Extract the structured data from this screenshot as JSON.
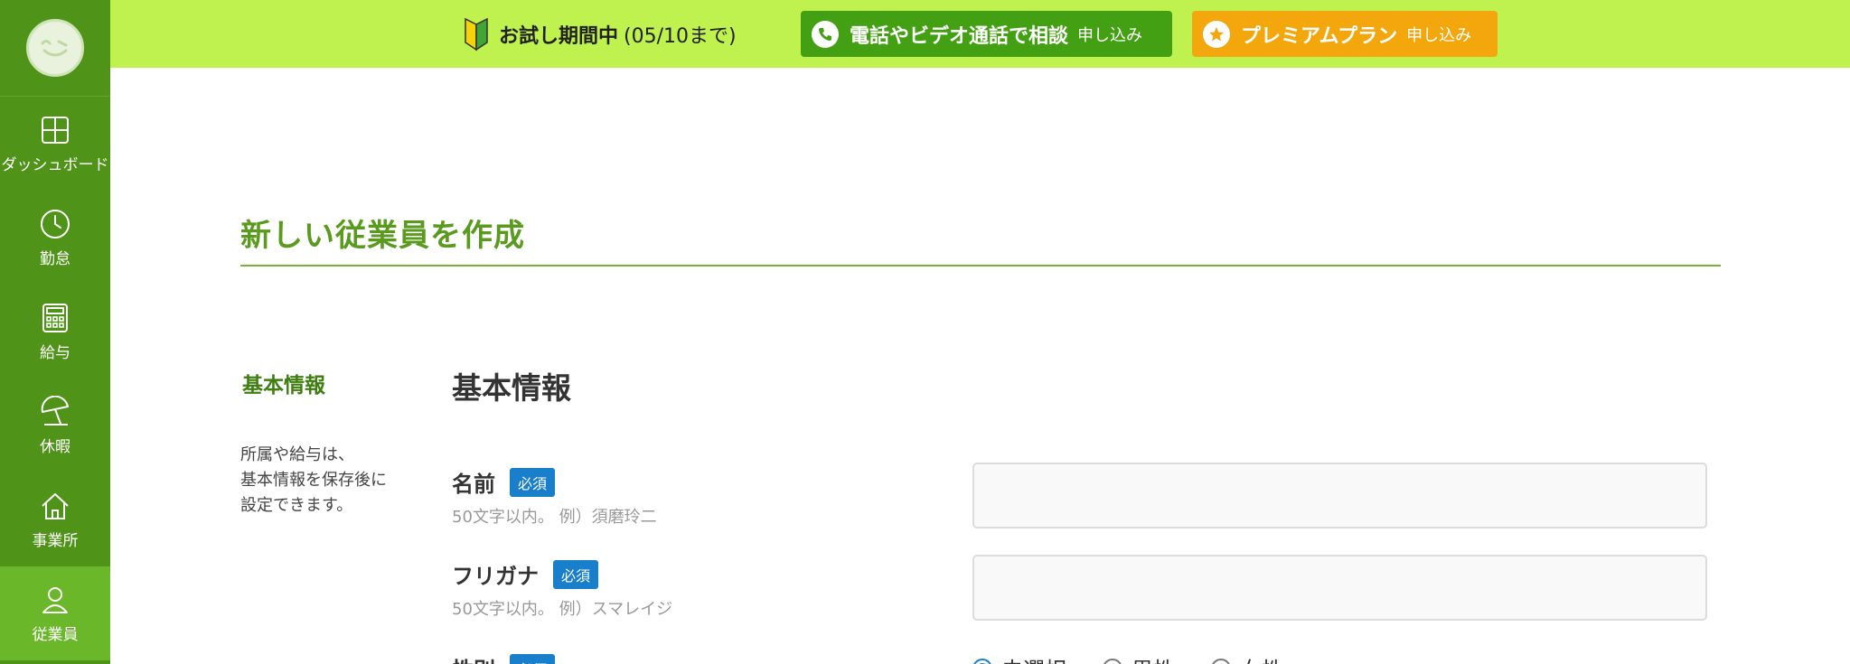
{
  "sidebar": {
    "items": [
      {
        "label": "ダッシュボード",
        "icon": "dashboard-icon"
      },
      {
        "label": "勤怠",
        "icon": "clock-icon"
      },
      {
        "label": "給与",
        "icon": "calculator-icon"
      },
      {
        "label": "休暇",
        "icon": "beach-umbrella-icon"
      },
      {
        "label": "事業所",
        "icon": "home-icon"
      },
      {
        "label": "従業員",
        "icon": "person-icon",
        "active": true
      }
    ]
  },
  "topbar": {
    "trial_bold": "お試し期間中",
    "trial_period": "(05/10まで)",
    "call_label": "電話やビデオ通話で相談",
    "call_sub": "申し込み",
    "premium_label": "プレミアムプラン",
    "premium_sub": "申し込み"
  },
  "page": {
    "title": "新しい従業員を作成"
  },
  "section": {
    "nav_title": "基本情報",
    "note_lines": [
      "所属や給与は、",
      "基本情報を保存後に",
      "設定できます。"
    ],
    "heading": "基本情報",
    "fields": {
      "name": {
        "label": "名前",
        "badge": "必須",
        "hint": "50文字以内。 例）須磨玲二",
        "value": ""
      },
      "kana": {
        "label": "フリガナ",
        "badge": "必須",
        "hint": "50文字以内。 例）スマレイジ",
        "value": ""
      },
      "gender": {
        "label": "性別",
        "badge": "必須",
        "options": [
          "未選択",
          "男性",
          "女性"
        ],
        "selected": "未選択"
      }
    }
  },
  "colors": {
    "sidebar": "#4f9419",
    "sidebar_active": "#6ab82a",
    "topbar": "#bff24f",
    "call_button": "#43a012",
    "premium_button": "#f4a70d",
    "title": "#5a9b1f",
    "badge": "#1a7fca"
  }
}
